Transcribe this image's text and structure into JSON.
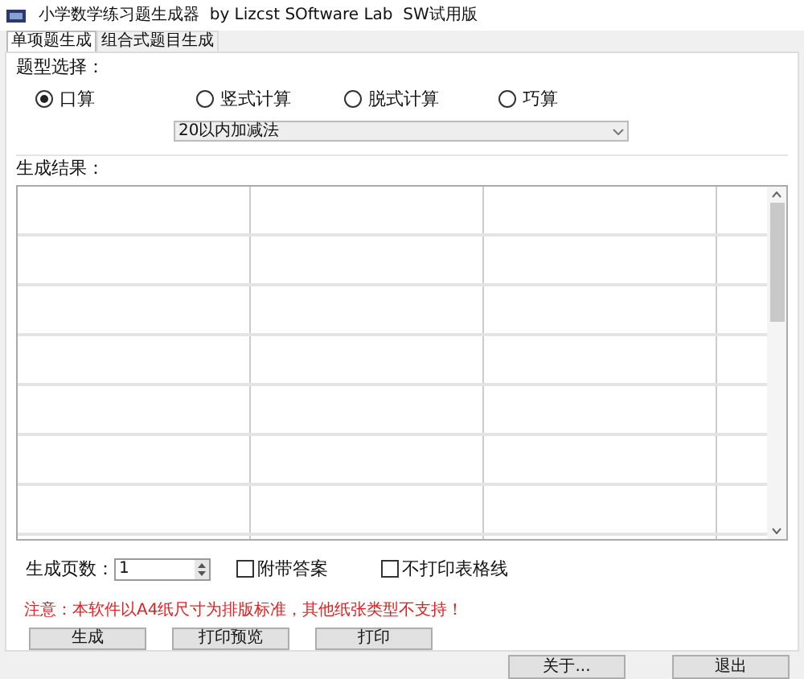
{
  "window": {
    "title": "小学数学练习题生成器  by Lizcst SOftware Lab  SW试用版"
  },
  "tabs": [
    {
      "label": "单项题生成",
      "selected": true
    },
    {
      "label": "组合式题目生成",
      "selected": false
    }
  ],
  "question_type": {
    "label": "题型选择：",
    "options": [
      {
        "label": "口算",
        "selected": true
      },
      {
        "label": "竖式计算",
        "selected": false
      },
      {
        "label": "脱式计算",
        "selected": false
      },
      {
        "label": "巧算",
        "selected": false
      }
    ],
    "dropdown": {
      "value": "20以内加减法"
    }
  },
  "results": {
    "label": "生成结果："
  },
  "pages": {
    "label": "生成页数：",
    "value": "1"
  },
  "checkboxes": [
    {
      "label": "附带答案",
      "checked": false
    },
    {
      "label": "不打印表格线",
      "checked": false
    }
  ],
  "notice": "注意：本软件以A4纸尺寸为排版标准，其他纸张类型不支持！",
  "action_buttons": [
    "生成",
    "打印预览",
    "打印"
  ],
  "footer_buttons": [
    "关于...",
    "退出"
  ]
}
